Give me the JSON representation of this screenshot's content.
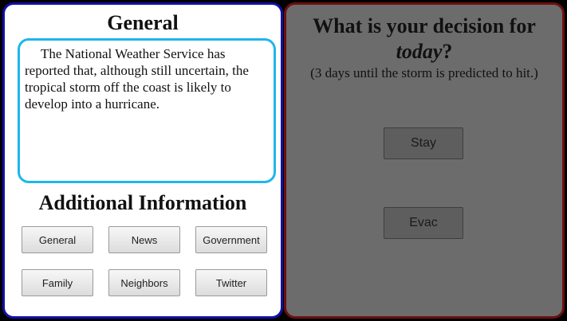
{
  "left": {
    "title": "General",
    "news_text": "The National Weather Service has reported that, although still uncertain, the tropical storm off the coast is likely to develop into a hurricane.",
    "additional_title": "Additional Information",
    "buttons": [
      "General",
      "News",
      "Government",
      "Family",
      "Neighbors",
      "Twitter"
    ]
  },
  "right": {
    "question_line1": "What is your decision for",
    "question_emphasis": "today",
    "question_end": "?",
    "subtext": "(3 days until the storm is predicted to hit.)",
    "stay_label": "Stay",
    "evac_label": "Evac"
  },
  "colors": {
    "left_border": "#1010a8",
    "news_border": "#1fb6ec",
    "right_border": "#6b1010",
    "right_overlay": "#6c6c6c"
  }
}
